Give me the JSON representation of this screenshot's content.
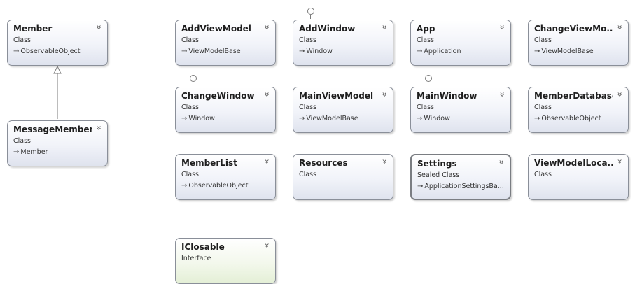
{
  "diagram": {
    "classes": [
      {
        "id": "member",
        "name": "Member",
        "kind": "Class",
        "base": "ObservableObject"
      },
      {
        "id": "messagemember",
        "name": "MessageMember",
        "kind": "Class",
        "base": "Member"
      },
      {
        "id": "addviewmodel",
        "name": "AddViewModel",
        "kind": "Class",
        "base": "ViewModelBase"
      },
      {
        "id": "addwindow",
        "name": "AddWindow",
        "kind": "Class",
        "base": "Window",
        "lollipop": true
      },
      {
        "id": "app",
        "name": "App",
        "kind": "Class",
        "base": "Application"
      },
      {
        "id": "changeviewmodel",
        "name": "ChangeViewMo...",
        "kind": "Class",
        "base": "ViewModelBase"
      },
      {
        "id": "changewindow",
        "name": "ChangeWindow",
        "kind": "Class",
        "base": "Window",
        "lollipop": true
      },
      {
        "id": "mainviewmodel",
        "name": "MainViewModel",
        "kind": "Class",
        "base": "ViewModelBase"
      },
      {
        "id": "mainwindow",
        "name": "MainWindow",
        "kind": "Class",
        "base": "Window",
        "lollipop": true
      },
      {
        "id": "memberdatabase",
        "name": "MemberDatabase",
        "kind": "Class",
        "base": "ObservableObject"
      },
      {
        "id": "memberlist",
        "name": "MemberList",
        "kind": "Class",
        "base": "ObservableObject"
      },
      {
        "id": "resources",
        "name": "Resources",
        "kind": "Class",
        "base": ""
      },
      {
        "id": "settings",
        "name": "Settings",
        "kind": "Sealed Class",
        "base": "ApplicationSettingsBa...",
        "selected": true
      },
      {
        "id": "viewmodellocator",
        "name": "ViewModelLoca...",
        "kind": "Class",
        "base": ""
      },
      {
        "id": "iclosable",
        "name": "IClosable",
        "kind": "Interface",
        "base": "",
        "interface": true
      }
    ],
    "inheritance": [
      {
        "from": "messagemember",
        "to": "member"
      }
    ],
    "icons": {
      "collapse": "double-chevron-down-icon",
      "inherits": "inherits-arrow-icon",
      "interface_lollipop": "interface-lollipop-icon"
    },
    "colors": {
      "class_fill": "#e6e9f2",
      "interface_fill": "#e8f1dc",
      "border": "#8a8f99"
    }
  }
}
